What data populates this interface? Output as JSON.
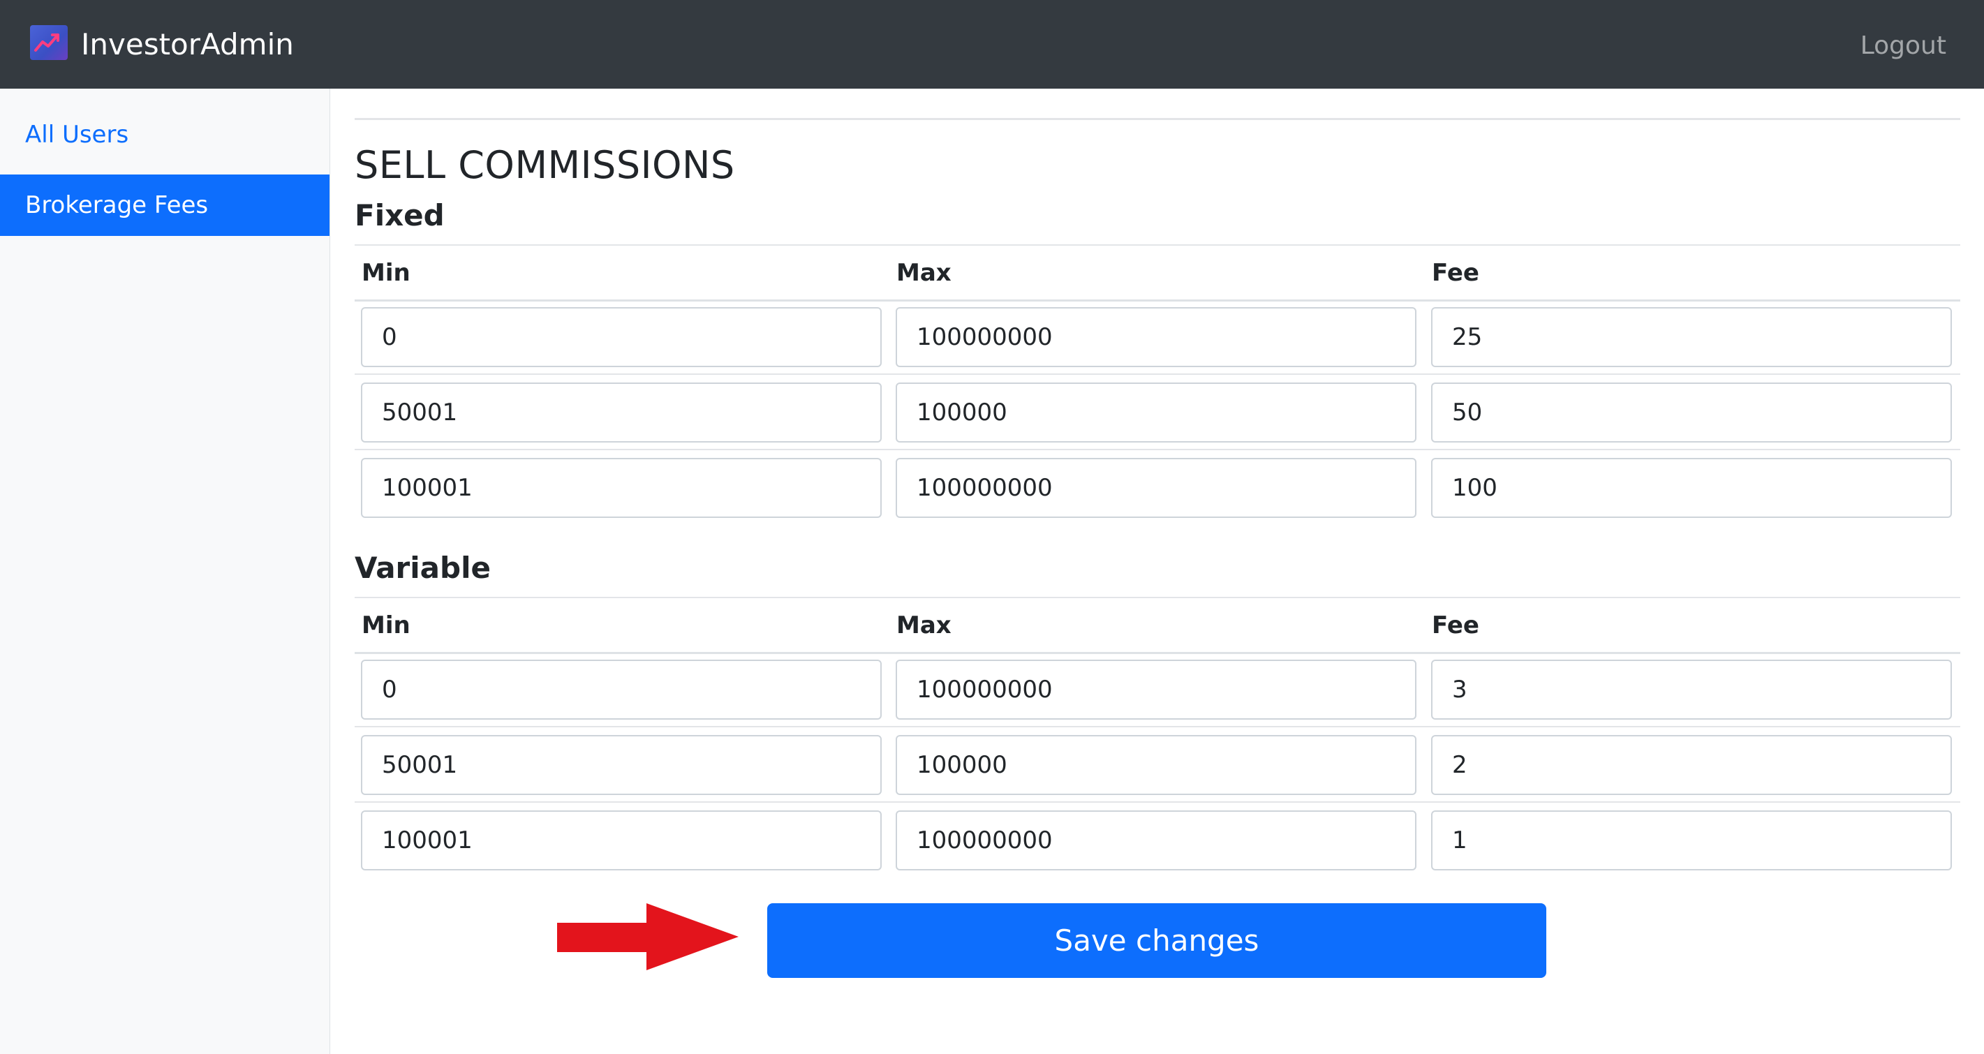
{
  "navbar": {
    "brand": "InvestorAdmin",
    "logo_icon": "trend-chart-icon",
    "logout": "Logout"
  },
  "sidebar": {
    "items": [
      {
        "label": "All Users",
        "active": false
      },
      {
        "label": "Brokerage Fees",
        "active": true
      }
    ]
  },
  "main": {
    "title": "SELL COMMISSIONS",
    "sections": [
      {
        "title": "Fixed",
        "headers": [
          "Min",
          "Max",
          "Fee"
        ],
        "rows": [
          [
            "0",
            "100000000",
            "25"
          ],
          [
            "50001",
            "100000",
            "50"
          ],
          [
            "100001",
            "100000000",
            "100"
          ]
        ]
      },
      {
        "title": "Variable",
        "headers": [
          "Min",
          "Max",
          "Fee"
        ],
        "rows": [
          [
            "0",
            "100000000",
            "3"
          ],
          [
            "50001",
            "100000",
            "2"
          ],
          [
            "100001",
            "100000000",
            "1"
          ]
        ]
      }
    ],
    "save_label": "Save changes"
  },
  "colors": {
    "navbar_bg": "#343a40",
    "primary": "#0d6efd",
    "sidebar_bg": "#f8f9fa",
    "annotation_arrow": "#e3141c"
  },
  "annotation_icon": "red-arrow-icon"
}
